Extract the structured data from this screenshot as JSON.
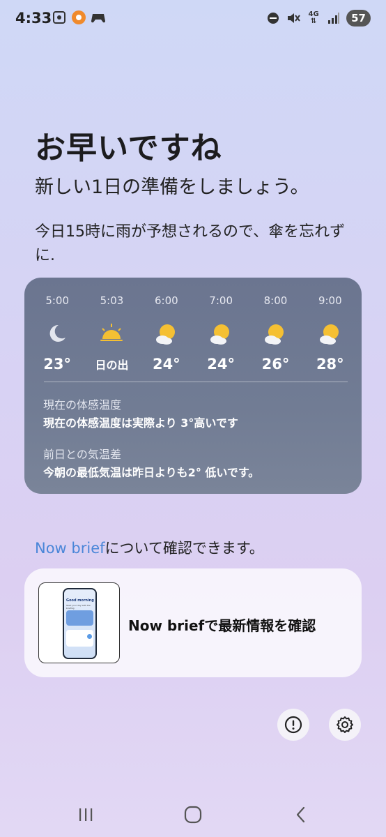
{
  "status_bar": {
    "time": "4:33",
    "battery": "57",
    "network": "4G",
    "icons_left": [
      "screenshot-icon",
      "app-badge-icon",
      "game-controller-icon"
    ],
    "icons_right": [
      "do-not-disturb-icon",
      "mute-icon",
      "4g-icon",
      "signal-icon",
      "battery-icon"
    ]
  },
  "greeting": {
    "headline": "お早いですね",
    "subline": "新しい1日の準備をしましょう。",
    "notice": "今日15時に雨が予想されるので、傘を忘れずに."
  },
  "weather": {
    "hours": [
      {
        "time": "5:00",
        "icon": "moon-icon",
        "temp": "23°"
      },
      {
        "time": "5:03",
        "icon": "sunrise-icon",
        "temp": "日の出"
      },
      {
        "time": "6:00",
        "icon": "sun-cloud-icon",
        "temp": "24°"
      },
      {
        "time": "7:00",
        "icon": "sun-cloud-icon",
        "temp": "24°"
      },
      {
        "time": "8:00",
        "icon": "sun-cloud-icon",
        "temp": "26°"
      },
      {
        "time": "9:00",
        "icon": "sun-cloud-icon",
        "temp": "28°"
      }
    ],
    "feel_label": "現在の体感温度",
    "feel_text": "現在の体感温度は実際より 3°高いです",
    "diff_label": "前日との気温差",
    "diff_text": "今朝の最低気温は昨日よりも2° 低いです。"
  },
  "brief": {
    "link_text": "Now brief",
    "line_rest": "について確認できます。",
    "card_title": "Now briefで最新情報を確認",
    "thumb_title": "Good morning",
    "thumb_sub": "Start your day with the briefing"
  },
  "colors": {
    "accent_link": "#4a86d8",
    "weather_card": "#717c94",
    "sun": "#f5c033"
  }
}
